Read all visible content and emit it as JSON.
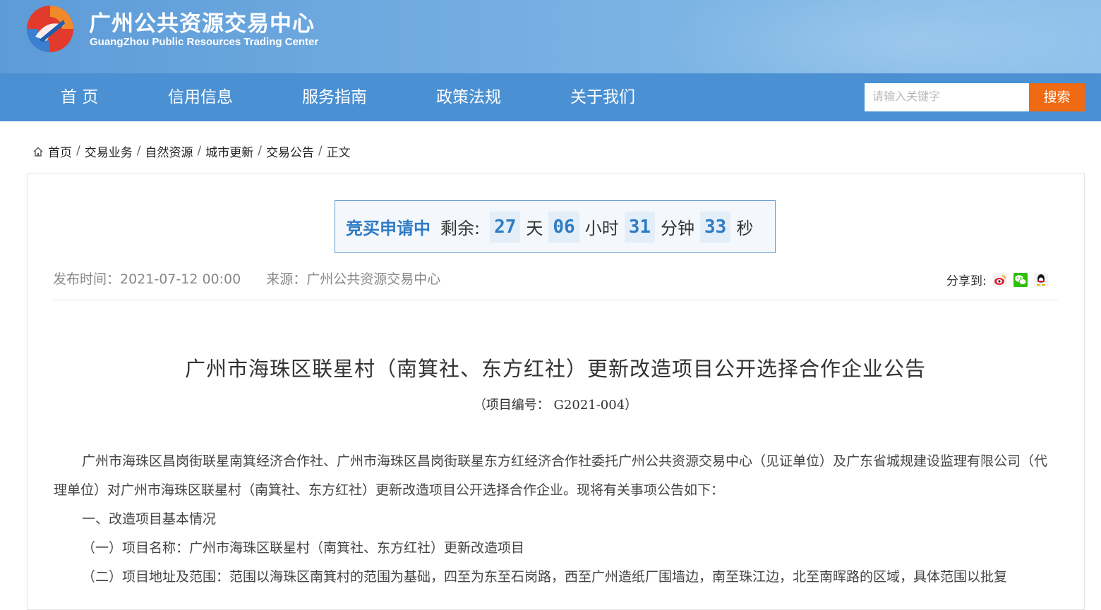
{
  "header": {
    "title": "广州公共资源交易中心",
    "subtitle": "GuangZhou Public Resources Trading Center"
  },
  "nav": {
    "items": [
      "首 页",
      "信用信息",
      "服务指南",
      "政策法规",
      "关于我们"
    ],
    "search_placeholder": "请输入关键字",
    "search_label": "搜索"
  },
  "breadcrumb": {
    "items": [
      "首页",
      "交易业务",
      "自然资源",
      "城市更新",
      "交易公告"
    ],
    "current": "正文",
    "separator": "/"
  },
  "countdown": {
    "status": "竞买申请中",
    "remaining_label": "剩余:",
    "days": "27",
    "days_unit": "天",
    "hours": "06",
    "hours_unit": "小时",
    "minutes": "31",
    "minutes_unit": "分钟",
    "seconds": "33",
    "seconds_unit": "秒"
  },
  "meta": {
    "publish_time": "发布时间：2021-07-12 00:00",
    "source": "来源：广州公共资源交易中心",
    "share_label": "分享到:"
  },
  "article": {
    "title": "广州市海珠区联星村（南箕社、东方红社）更新改造项目公开选择合作企业公告",
    "project_no": "（项目编号： G2021-004）",
    "paragraph1": "广州市海珠区昌岗街联星南箕经济合作社、广州市海珠区昌岗街联星东方红经济合作社委托广州公共资源交易中心（见证单位）及广东省城规建设监理有限公司（代理单位）对广州市海珠区联星村（南箕社、东方红社）更新改造项目公开选择合作企业。现将有关事项公告如下：",
    "section1": "一、改造项目基本情况",
    "item1": "（一）项目名称：广州市海珠区联星村（南箕社、东方红社）更新改造项目",
    "item2": "（二）项目地址及范围：范围以海珠区南箕村的范围为基础，四至为东至石岗路，西至广州造纸厂围墙边，南至珠江边，北至南晖路的区域，具体范围以批复"
  },
  "colors": {
    "banner": "#6aa6dd",
    "nav": "#4a90d2",
    "search_button": "#ee6a13",
    "countdown_accent": "#2f7bc5"
  },
  "icons": {
    "logo": "logo-icon",
    "home": "home-icon",
    "share": [
      "weibo-icon",
      "wechat-icon",
      "qq-icon"
    ]
  }
}
